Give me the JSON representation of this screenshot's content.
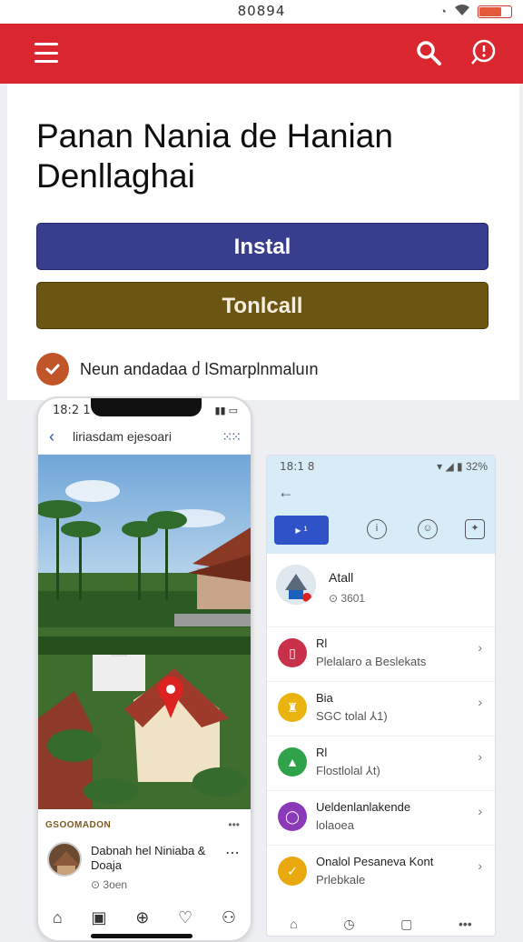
{
  "status": {
    "time": "80894"
  },
  "hero": {
    "title_line1": "Panan Nania de Hanian",
    "title_line2": "Denllaghai",
    "install_label": "Instal",
    "second_label": "Tonlcall",
    "check_label": "Neun andadaa ძ lSmarplnmaluın"
  },
  "phone": {
    "status_time": "18:2 1",
    "header_title": "liriasdam ejesoari",
    "section_label": "GSOOMADON",
    "item_title": "Dabnah hel Niniaba & Doaja",
    "item_meta": "3oen",
    "colors": {
      "accent": "#2a4fb5"
    }
  },
  "tablet": {
    "status_time": "18:1 8",
    "status_right": "32%",
    "tab_icons": [
      "info-icon",
      "emoji-icon",
      "settings-icon"
    ],
    "profile_name": "Atall",
    "profile_meta": "3601",
    "rows": [
      {
        "l1": "Rl",
        "l2": "Plelalaro a Beslekats",
        "icon": "bookmark-icon",
        "color": "#c9304a"
      },
      {
        "l1": "Bia",
        "l2": "SGC tolal ⅄1)",
        "icon": "trophy-icon",
        "color": "#e9b40e"
      },
      {
        "l1": "Rl",
        "l2": "Flostlolal ⅄t)",
        "icon": "triangle-icon",
        "color": "#2fa34a"
      },
      {
        "l1": "Ueldenlanlakende",
        "l2": "lolaoea",
        "icon": "circle-icon",
        "color": "#8a3ab9"
      },
      {
        "l1": "Onalol Pesaneva Kont",
        "l2": "Prlebkale",
        "icon": "medal-icon",
        "color": "#e9a90e"
      }
    ]
  }
}
